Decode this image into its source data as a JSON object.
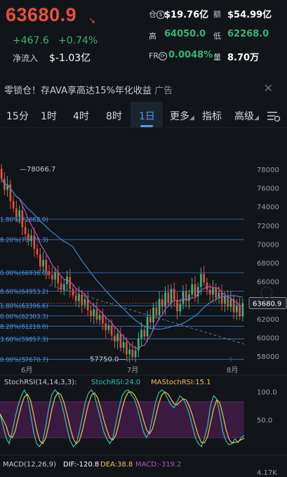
{
  "header": {
    "price": "63680.9",
    "price_arrow": "↘",
    "change_abs": "+467.6",
    "change_pct": "+0.74%",
    "net_inflow_label": "净流入",
    "net_inflow_value": "$-1.03亿",
    "stats": {
      "position_label": "仓",
      "position_value": "$19.76亿",
      "turnover_label": "额",
      "turnover_value": "$54.99亿",
      "high_label": "高",
      "high_value": "64050.0",
      "low_label": "低",
      "low_value": "62268.0",
      "funding_label": "FR",
      "funding_value": "0.0048%",
      "volume_label": "量",
      "volume_value": "8.70万"
    }
  },
  "ad": {
    "text": "零锁仓！存AVA享高达15%年化收益",
    "tag": "广告",
    "close": "✕"
  },
  "tabs": [
    "15分",
    "1时",
    "4时",
    "8时",
    "1日",
    "更多",
    "指标",
    "高级"
  ],
  "active_tab": "1日",
  "chart_data": {
    "type": "candlestick",
    "y_axis_labels": [
      "78000",
      "76000",
      "74000",
      "72000",
      "70000",
      "68000",
      "66000",
      "64000",
      "62000",
      "60000",
      "58000"
    ],
    "x_axis_labels": [
      "6月",
      "7月",
      "8月"
    ],
    "current_price_tag": "63680.9",
    "high_marker": "78066.7",
    "low_marker": "57750.0",
    "fib_levels": [
      {
        "label": "1.80%(72662.0)",
        "value": 72662.0
      },
      {
        "label": "8.20%(70475.3)",
        "value": 70475.3
      },
      {
        "label": "0.00%(66936.0)",
        "value": 66936.0
      },
      {
        "label": "8.60%(64953.2)",
        "value": 64953.2
      },
      {
        "label": "1.80%(63396.6)",
        "value": 63396.6
      },
      {
        "label": "0.00%(62303.3)",
        "value": 62303.3
      },
      {
        "label": "8.20%(61210.0)",
        "value": 61210.0
      },
      {
        "label": "3.60%(59857.3)",
        "value": 59857.3
      },
      {
        "label": "0.00%(57670.7)",
        "value": 57670.7
      }
    ],
    "stochrsi": {
      "params_label": "StochRSI(14,14,3,3):",
      "k_label": "StochRSI:24.0",
      "d_label": "MAStochRSI:15.1",
      "axis_labels": [
        "100.0",
        "50.0"
      ]
    },
    "macd": {
      "params_label": "MACD(12,26,9)",
      "dif_label": "DIF:-120.8",
      "dea_label": "DEA:38.8",
      "macd_label": "MACD:-319.2",
      "axis_label": "4.17K"
    }
  }
}
